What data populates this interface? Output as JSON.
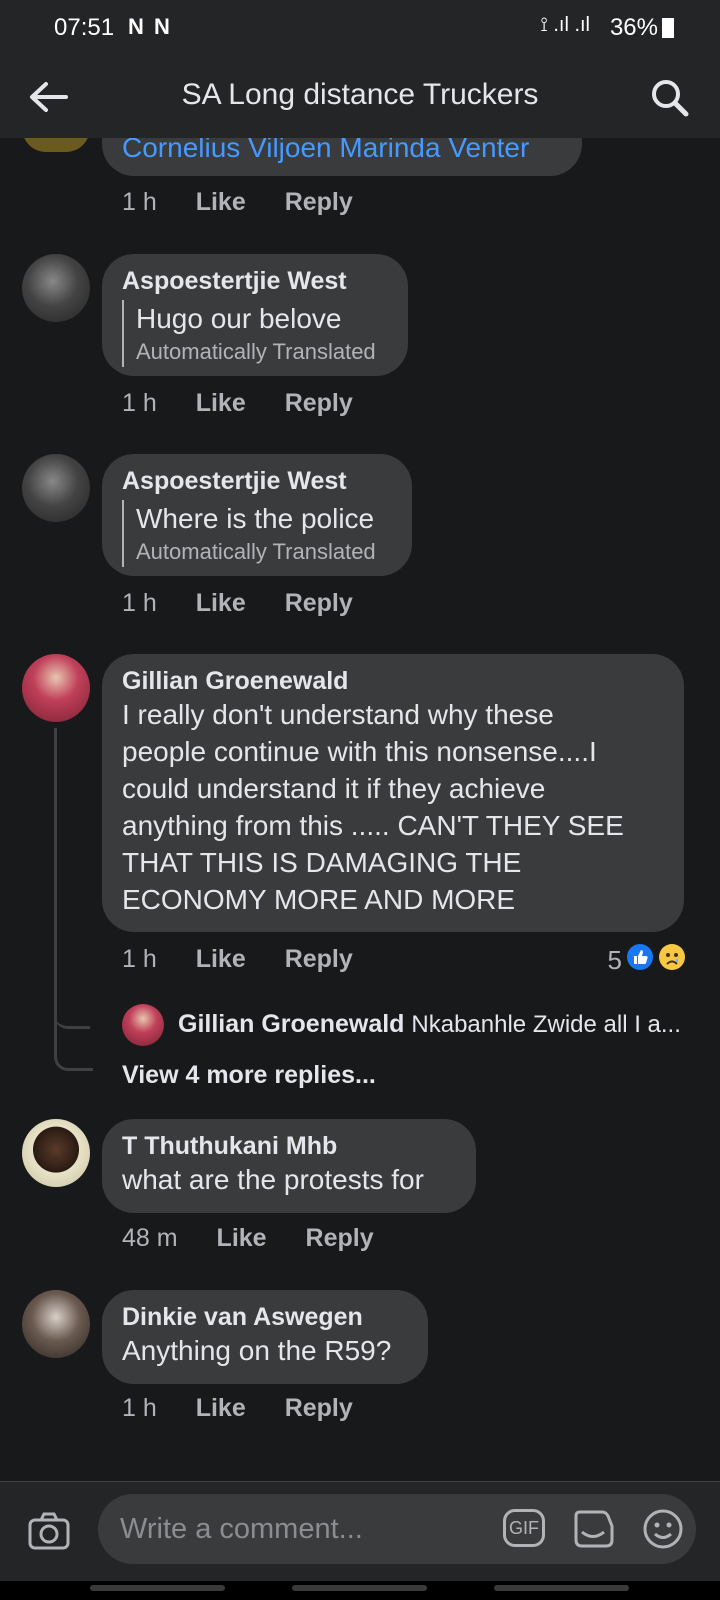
{
  "status_bar": {
    "time": "07:51",
    "left_icons": "N N",
    "battery": "36%",
    "signal_text": "⟟ .ıl .ıl"
  },
  "header": {
    "title": "SA Long distance Truckers"
  },
  "comments": [
    {
      "author": "",
      "text": "Cornelius Viljoen Marinda Venter",
      "time": "1 h",
      "like": "Like",
      "reply": "Reply"
    },
    {
      "author": "Aspoestertjie West",
      "text": "Hugo our belove",
      "translated_label": "Automatically Translated",
      "time": "1 h",
      "like": "Like",
      "reply": "Reply"
    },
    {
      "author": "Aspoestertjie West",
      "text": "Where is the police",
      "translated_label": "Automatically Translated",
      "time": "1 h",
      "like": "Like",
      "reply": "Reply"
    },
    {
      "author": "Gillian Groenewald",
      "text_lines": [
        "I really don't understand why these",
        "people continue with this nonsense....I",
        "could understand it if they achieve",
        "anything from this ..... CAN'T THEY SEE",
        "THAT THIS IS DAMAGING THE",
        "ECONOMY MORE AND MORE"
      ],
      "time": "1 h",
      "like": "Like",
      "reply": "Reply",
      "reaction_count": "5",
      "reply_preview": {
        "author": "Gillian Groenewald",
        "text": "Nkabanhle Zwide all I a..."
      },
      "more_replies": "View 4 more replies..."
    },
    {
      "author": "T Thuthukani Mhb",
      "text": "what are the protests for",
      "time": "48 m",
      "like": "Like",
      "reply": "Reply"
    },
    {
      "author": "Dinkie van Aswegen",
      "text": "Anything on the R59?",
      "time": "1 h",
      "like": "Like",
      "reply": "Reply"
    }
  ],
  "composer": {
    "placeholder": "Write a comment...",
    "gif_label": "GIF"
  },
  "colors": {
    "background": "#18191a",
    "bubble": "#3a3b3c",
    "link": "#4599ff",
    "like_blue": "#1877f2"
  }
}
